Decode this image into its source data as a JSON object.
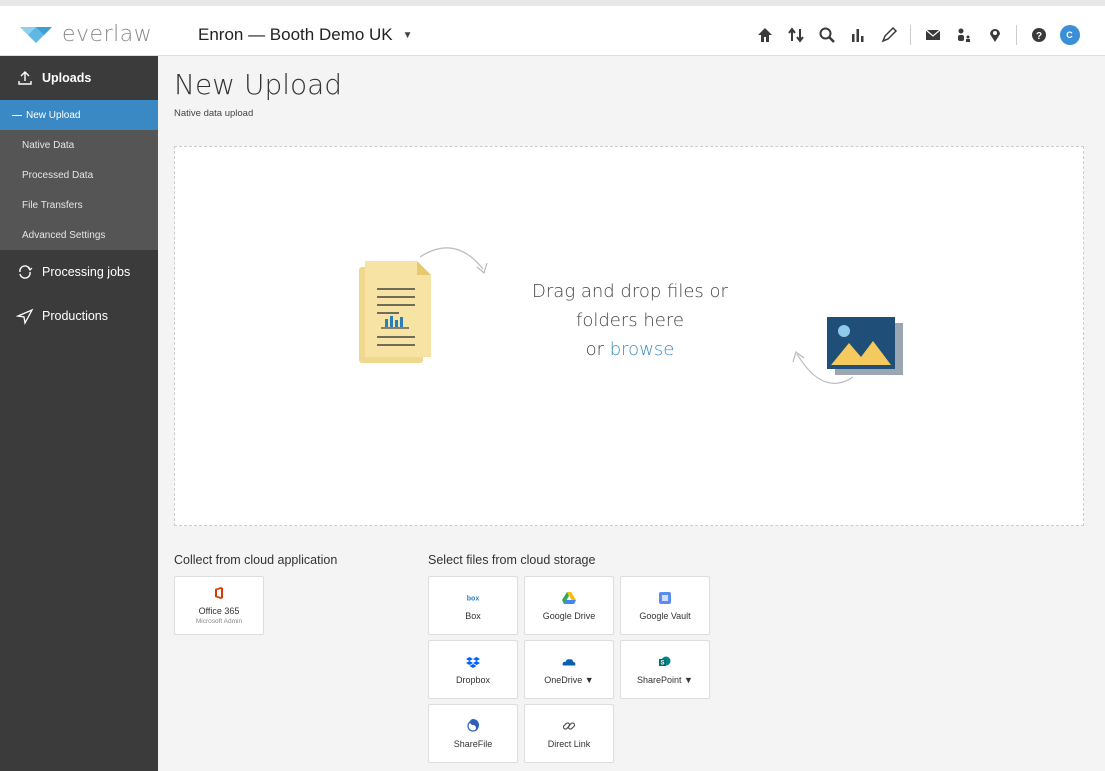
{
  "header": {
    "logo_text": "everlaw",
    "workspace": "Enron — Booth Demo UK",
    "avatar_initials": "C"
  },
  "icons": {
    "home": "home-icon",
    "upload": "upload-download-icon",
    "search": "search-icon",
    "analytics": "bar-chart-icon",
    "storybuilder": "pen-icon",
    "messages": "envelope-icon",
    "users": "users-icon",
    "location": "map-pin-icon",
    "help": "help-icon",
    "avatar": "avatar"
  },
  "sidebar": {
    "sections": [
      {
        "label": "Uploads",
        "icon": "upload-icon"
      },
      {
        "label": "Processing jobs",
        "icon": "processing-icon"
      },
      {
        "label": "Productions",
        "icon": "send-icon"
      }
    ],
    "items": [
      {
        "label": "New Upload",
        "active": true
      },
      {
        "label": "Native Data",
        "active": false
      },
      {
        "label": "Processed Data",
        "active": false
      },
      {
        "label": "File Transfers",
        "active": false
      },
      {
        "label": "Advanced Settings",
        "active": false
      }
    ]
  },
  "main": {
    "title": "New Upload",
    "subtitle": "Native data upload",
    "dropzone": {
      "line1": "Drag and drop files or",
      "line2": "folders here",
      "line3_prefix": "or ",
      "browse": "browse"
    }
  },
  "cloud_apps": {
    "heading": "Collect from cloud application",
    "tiles": [
      {
        "label": "Office 365",
        "sub": "Microsoft Admin",
        "icon": "office-365-icon"
      }
    ]
  },
  "cloud_storage": {
    "heading": "Select files from cloud storage",
    "tiles": [
      {
        "label": "Box",
        "icon": "box-icon"
      },
      {
        "label": "Google Drive",
        "icon": "google-drive-icon"
      },
      {
        "label": "Google Vault",
        "icon": "google-vault-icon"
      },
      {
        "label": "Dropbox",
        "icon": "dropbox-icon"
      },
      {
        "label": "OneDrive ▼",
        "icon": "onedrive-icon"
      },
      {
        "label": "SharePoint ▼",
        "icon": "sharepoint-icon"
      },
      {
        "label": "ShareFile",
        "icon": "sharefile-icon"
      },
      {
        "label": "Direct Link",
        "icon": "link-icon"
      }
    ]
  },
  "colors": {
    "accent": "#3a88c4",
    "sidebar": "#3b3b3b",
    "sidebar_sub": "#555555"
  }
}
